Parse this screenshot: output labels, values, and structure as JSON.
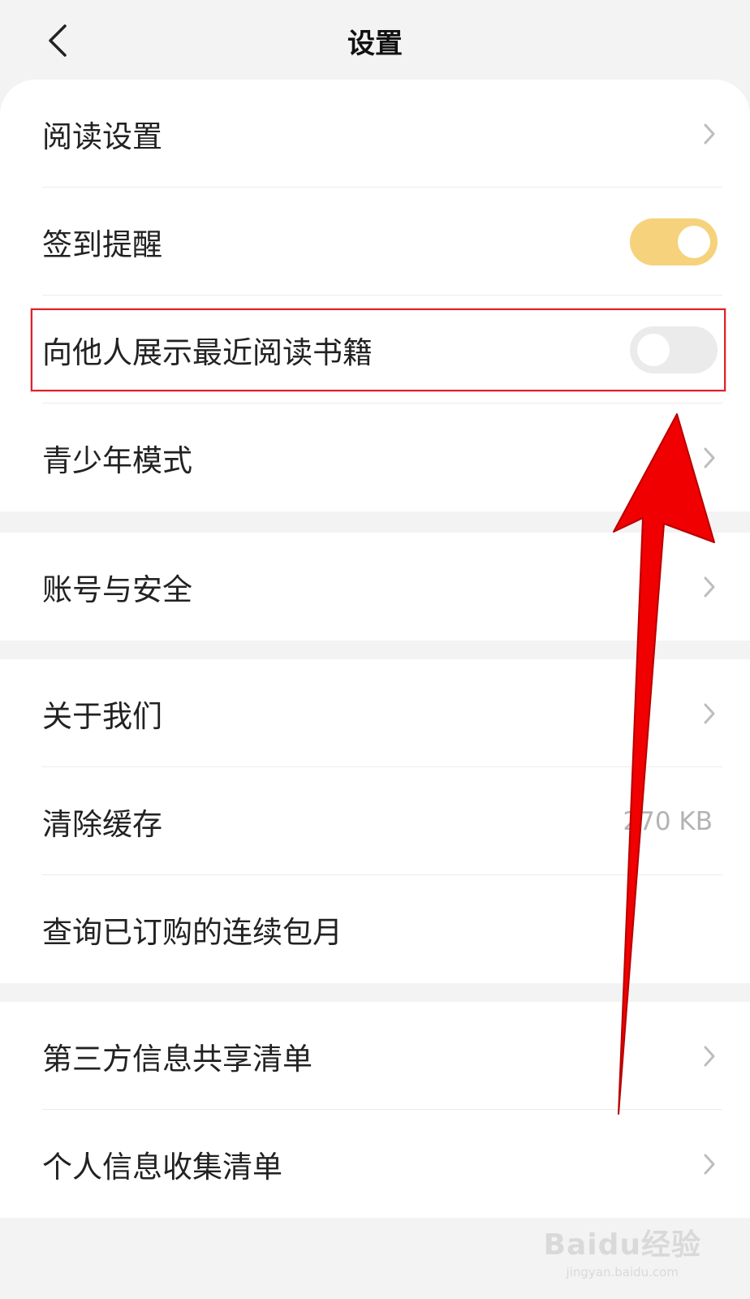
{
  "header": {
    "title": "设置"
  },
  "sections": [
    {
      "rows": [
        {
          "label": "阅读设置",
          "control": "chevron"
        },
        {
          "label": "签到提醒",
          "control": "toggle",
          "state": "on"
        },
        {
          "label": "向他人展示最近阅读书籍",
          "control": "toggle",
          "state": "off"
        },
        {
          "label": "青少年模式",
          "control": "chevron"
        }
      ]
    },
    {
      "rows": [
        {
          "label": "账号与安全",
          "control": "chevron"
        }
      ]
    },
    {
      "rows": [
        {
          "label": "关于我们",
          "control": "chevron"
        },
        {
          "label": "清除缓存",
          "control": "value",
          "value": "270 KB"
        },
        {
          "label": "查询已订购的连续包月",
          "control": "none"
        }
      ]
    },
    {
      "rows": [
        {
          "label": "第三方信息共享清单",
          "control": "chevron"
        },
        {
          "label": "个人信息收集清单",
          "control": "chevron"
        }
      ]
    }
  ],
  "colors": {
    "toggle_on": "#f5d27b",
    "toggle_off": "#ebebeb",
    "highlight": "#e0202a",
    "arrow": "#f00000"
  },
  "watermark": {
    "logo": "Baidu经验",
    "url": "jingyan.baidu.com"
  }
}
